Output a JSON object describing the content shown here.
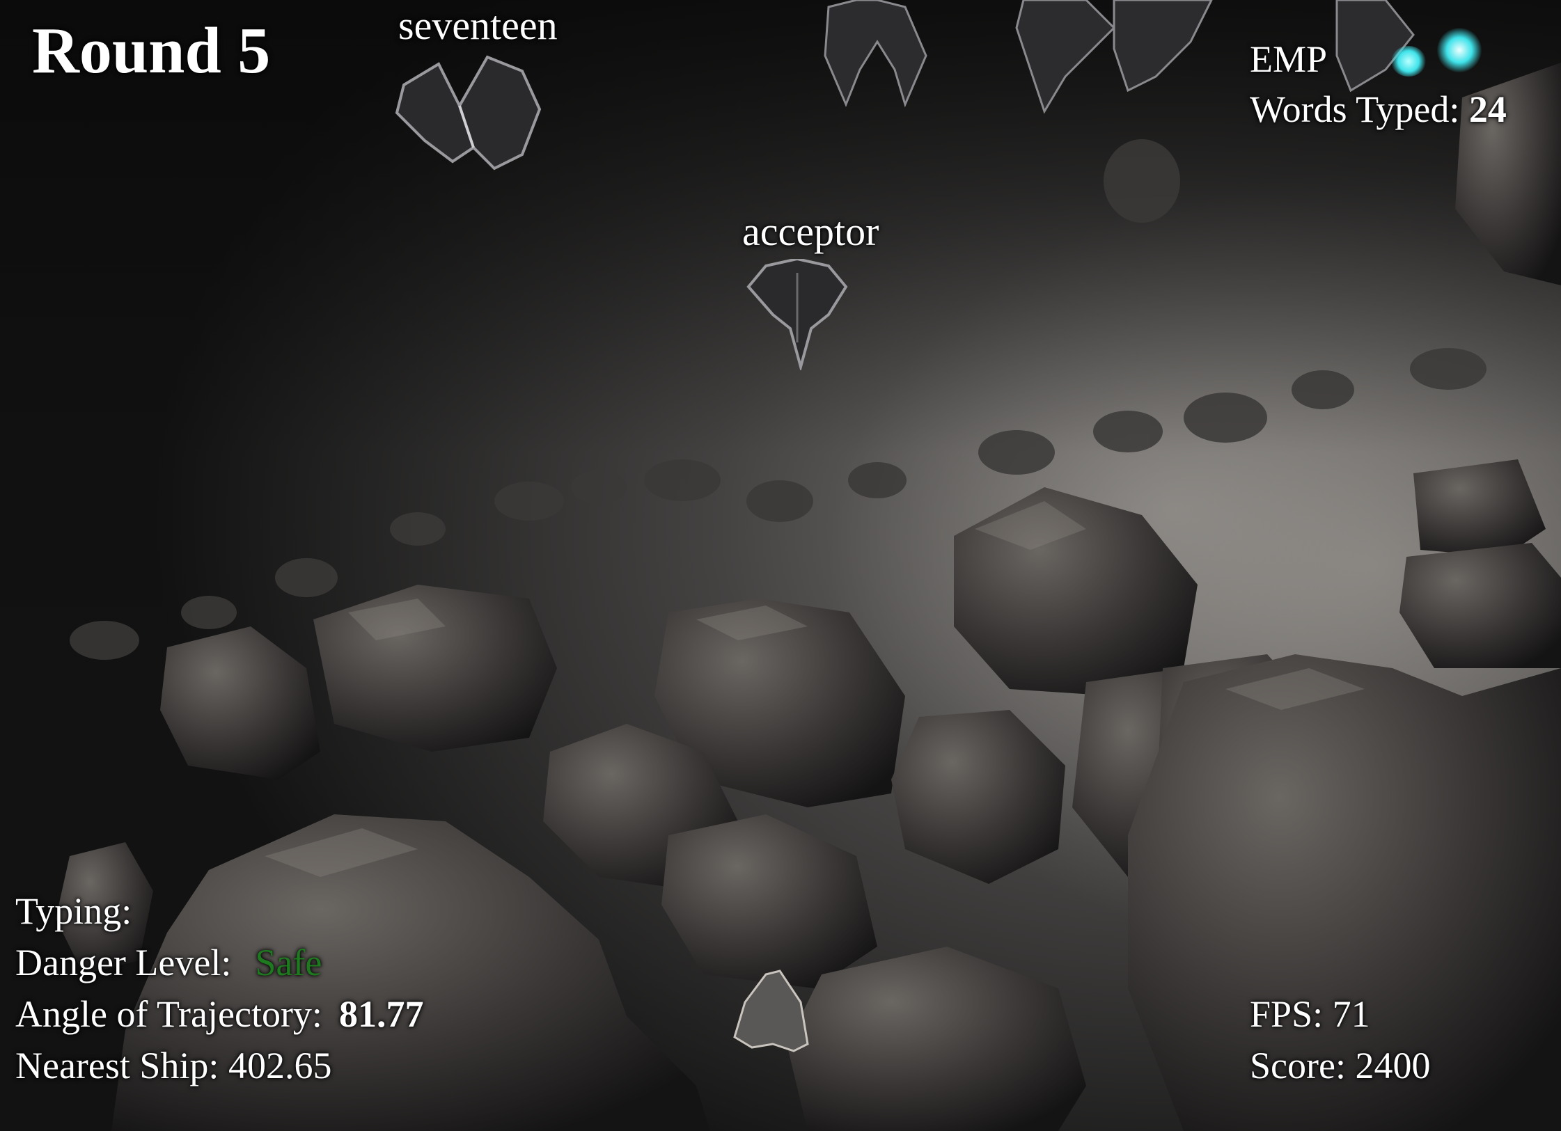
{
  "hud": {
    "round_label": "Round 5",
    "emp_label": "EMP",
    "emp_charges": 2,
    "words_typed_label": "Words Typed:",
    "words_typed_value": "24",
    "typing_label": "Typing:",
    "typing_value": "",
    "danger_label": "Danger Level:",
    "danger_value": "Safe",
    "danger_color": "#1e7a1e",
    "angle_label": "Angle of Trajectory:",
    "angle_value": "81.77",
    "nearest_label": "Nearest Ship:",
    "nearest_value": "402.65",
    "fps_label": "FPS:",
    "fps_value": "71",
    "score_label": "Score:",
    "score_value": "2400"
  },
  "enemies": [
    {
      "word": "seventeen"
    },
    {
      "word": "acceptor"
    }
  ],
  "colors": {
    "emp_glow": "#3fe3ea",
    "rock_dark": "#2a2828",
    "rock_light": "#6e6a66"
  }
}
